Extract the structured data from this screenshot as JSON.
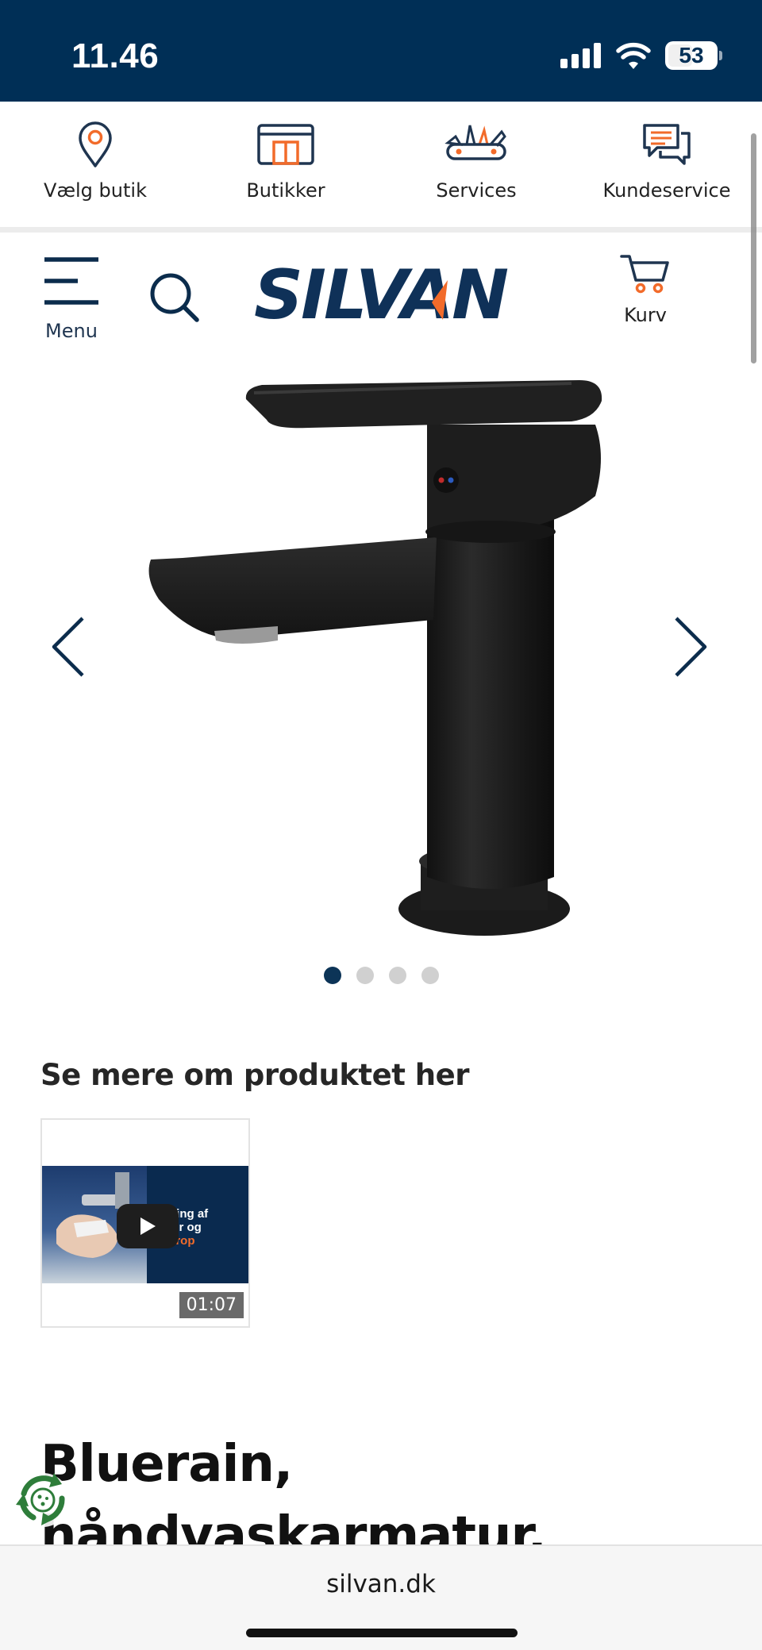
{
  "status_bar": {
    "time": "11.46",
    "battery": "53"
  },
  "service_nav": [
    {
      "label": "Vælg butik",
      "icon": "location-pin-icon"
    },
    {
      "label": "Butikker",
      "icon": "storefront-icon"
    },
    {
      "label": "Services",
      "icon": "multitool-icon"
    },
    {
      "label": "Kundeservice",
      "icon": "chat-bubbles-icon"
    }
  ],
  "header": {
    "menu_label": "Menu",
    "logo_text": "SILVAN",
    "cart_label": "Kurv"
  },
  "gallery": {
    "total_images": 4,
    "active_index": 0
  },
  "video_section": {
    "heading": "Se mere om produktet her",
    "thumbnail_text_line1": "tering af",
    "thumbnail_text_line2": "atur og",
    "thumbnail_text_line3": "dprop",
    "duration": "01:07"
  },
  "product": {
    "title": "Bluerain, håndvaskarmatur, Pinaki,"
  },
  "browser": {
    "url": "silvan.dk"
  },
  "colors": {
    "navy": "#002f56",
    "accent_orange": "#f26b2a",
    "recycle_green": "#2e7d3a"
  }
}
